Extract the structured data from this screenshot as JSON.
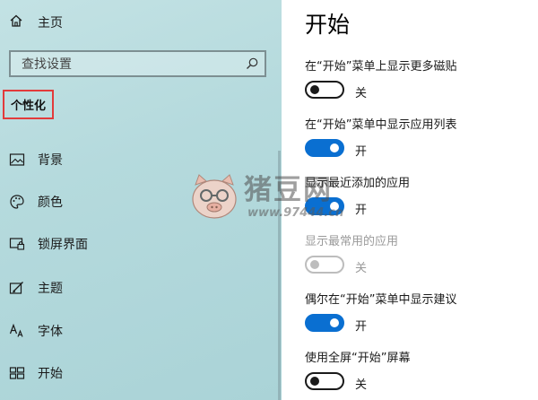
{
  "sidebar": {
    "home_label": "主页",
    "search_placeholder": "查找设置",
    "section_title": "个性化",
    "items": [
      {
        "label": "背景",
        "icon": "image-icon"
      },
      {
        "label": "颜色",
        "icon": "palette-icon"
      },
      {
        "label": "锁屏界面",
        "icon": "lock-screen-icon"
      },
      {
        "label": "主题",
        "icon": "theme-icon"
      },
      {
        "label": "字体",
        "icon": "font-icon"
      },
      {
        "label": "开始",
        "icon": "start-icon"
      }
    ]
  },
  "main": {
    "title": "开始",
    "settings": [
      {
        "label": "在“开始”菜单上显示更多磁贴",
        "state": "关",
        "on": false,
        "disabled": false
      },
      {
        "label": "在“开始”菜单中显示应用列表",
        "state": "开",
        "on": true,
        "disabled": false
      },
      {
        "label": "显示最近添加的应用",
        "state": "开",
        "on": true,
        "disabled": false
      },
      {
        "label": "显示最常用的应用",
        "state": "关",
        "on": false,
        "disabled": true
      },
      {
        "label": "偶尔在“开始”菜单中显示建议",
        "state": "开",
        "on": true,
        "disabled": false
      },
      {
        "label": "使用全屏“开始”屏幕",
        "state": "关",
        "on": false,
        "disabled": false
      }
    ]
  },
  "watermark": {
    "text": "猪豆网",
    "url": "www.97444.cn"
  },
  "colors": {
    "accent": "#0a6fd1",
    "highlight_border": "#e23b3b",
    "sidebar_bg": "#b5dadd"
  }
}
